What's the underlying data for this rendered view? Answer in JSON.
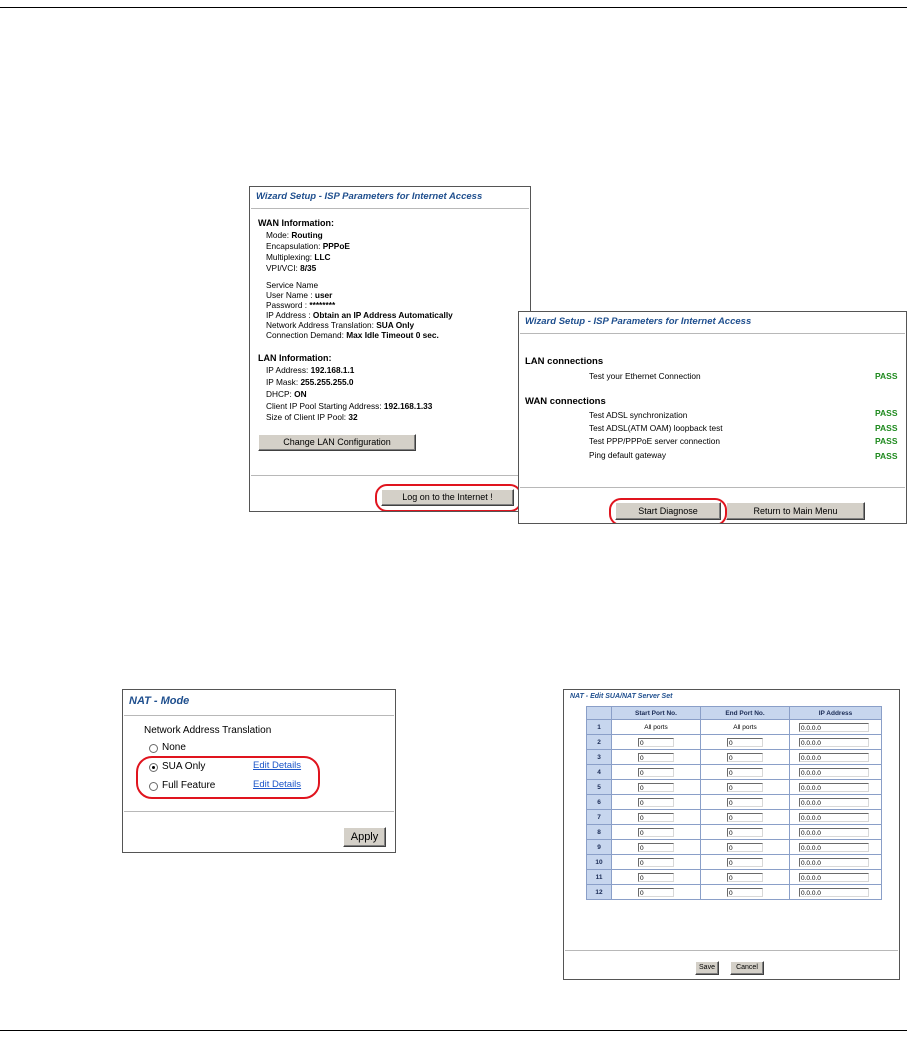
{
  "wan_panel": {
    "title": "Wizard Setup - ISP Parameters for Internet Access",
    "wan_header": "WAN Information:",
    "wan_rows": [
      {
        "label": "Mode: ",
        "value": "Routing"
      },
      {
        "label": "Encapsulation: ",
        "value": "PPPoE"
      },
      {
        "label": "Multiplexing: ",
        "value": "LLC"
      },
      {
        "label": "VPI/VCI: ",
        "value": "8/35"
      },
      {
        "label": "Service Name",
        "value": ""
      },
      {
        "label": "User Name : ",
        "value": "user"
      },
      {
        "label": "Password : ",
        "value": "********"
      },
      {
        "label": "IP Address : ",
        "value": "Obtain an IP Address Automatically"
      },
      {
        "label": "Network Address Translation: ",
        "value": "SUA Only"
      },
      {
        "label": "Connection Demand: ",
        "value": "Max Idle Timeout 0 sec."
      }
    ],
    "lan_header": "LAN Information:",
    "lan_rows": [
      {
        "label": "IP Address: ",
        "value": "192.168.1.1"
      },
      {
        "label": "IP Mask: ",
        "value": "255.255.255.0"
      },
      {
        "label": "DHCP: ",
        "value": "ON"
      },
      {
        "label": "Client IP Pool Starting Address: ",
        "value": "192.168.1.33"
      },
      {
        "label": "Size of Client IP Pool: ",
        "value": "32"
      }
    ],
    "change_lan_button": "Change LAN Configuration",
    "logon_button": "Log on to the Internet !"
  },
  "diag_panel": {
    "title": "Wizard Setup - ISP Parameters for Internet Access",
    "lan_header": "LAN connections",
    "wan_header": "WAN connections",
    "tests": [
      {
        "label": "Test your Ethernet Connection",
        "result": "PASS"
      },
      {
        "label": "Test ADSL synchronization",
        "result": "PASS"
      },
      {
        "label": "Test ADSL(ATM OAM) loopback test",
        "result": "PASS"
      },
      {
        "label": "Test PPP/PPPoE server connection",
        "result": "PASS"
      },
      {
        "label": "Ping default gateway",
        "result": "PASS"
      }
    ],
    "start_button": "Start Diagnose",
    "return_button": "Return to Main Menu"
  },
  "nat_mode": {
    "title": "NAT - Mode",
    "label": "Network Address Translation",
    "options": [
      {
        "label": "None",
        "selected": false
      },
      {
        "label": "SUA Only",
        "selected": true,
        "link": "Edit Details"
      },
      {
        "label": "Full Feature",
        "selected": false,
        "link": "Edit Details"
      }
    ],
    "apply_button": "Apply"
  },
  "nat_server": {
    "title": "NAT - Edit SUA/NAT Server Set",
    "headers": [
      "Start Port No.",
      "End Port No.",
      "IP Address"
    ],
    "rows": [
      {
        "idx": "1",
        "start": "All ports",
        "end": "All ports",
        "ip": "0.0.0.0"
      },
      {
        "idx": "2",
        "start": "0",
        "end": "0",
        "ip": "0.0.0.0"
      },
      {
        "idx": "3",
        "start": "0",
        "end": "0",
        "ip": "0.0.0.0"
      },
      {
        "idx": "4",
        "start": "0",
        "end": "0",
        "ip": "0.0.0.0"
      },
      {
        "idx": "5",
        "start": "0",
        "end": "0",
        "ip": "0.0.0.0"
      },
      {
        "idx": "6",
        "start": "0",
        "end": "0",
        "ip": "0.0.0.0"
      },
      {
        "idx": "7",
        "start": "0",
        "end": "0",
        "ip": "0.0.0.0"
      },
      {
        "idx": "8",
        "start": "0",
        "end": "0",
        "ip": "0.0.0.0"
      },
      {
        "idx": "9",
        "start": "0",
        "end": "0",
        "ip": "0.0.0.0"
      },
      {
        "idx": "10",
        "start": "0",
        "end": "0",
        "ip": "0.0.0.0"
      },
      {
        "idx": "11",
        "start": "0",
        "end": "0",
        "ip": "0.0.0.0"
      },
      {
        "idx": "12",
        "start": "0",
        "end": "0",
        "ip": "0.0.0.0"
      }
    ],
    "save_button": "Save",
    "cancel_button": "Cancel"
  }
}
